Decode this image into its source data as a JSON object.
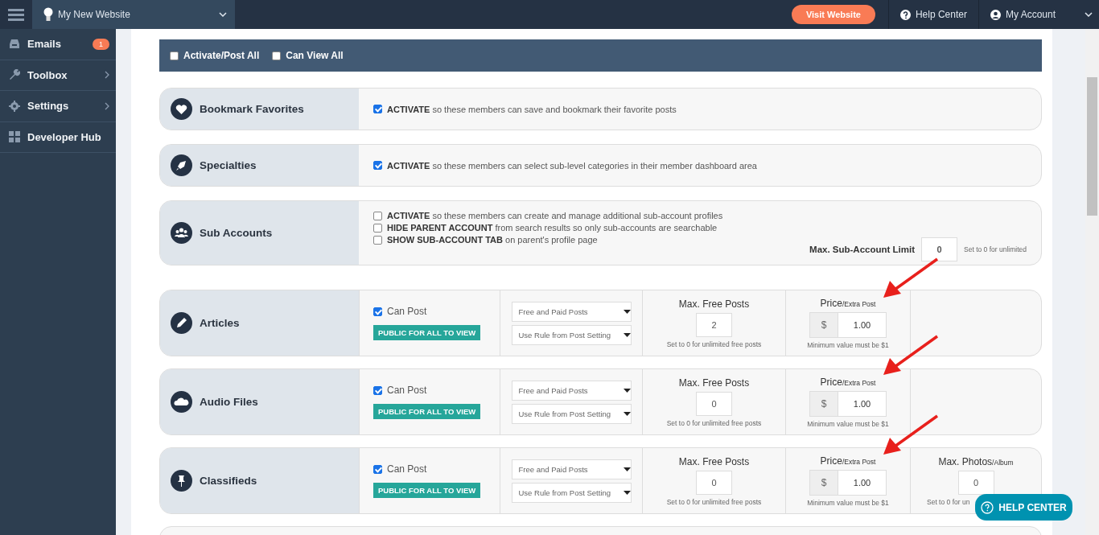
{
  "topbar": {
    "site_name": "My New Website",
    "visit_button": "Visit Website",
    "help_link": "Help Center",
    "account": "My Account"
  },
  "sidebar": {
    "items": [
      {
        "label": "Emails",
        "badge": "1",
        "has_submenu": false
      },
      {
        "label": "Toolbox",
        "has_submenu": true
      },
      {
        "label": "Settings",
        "has_submenu": true
      },
      {
        "label": "Developer Hub",
        "has_submenu": false
      }
    ]
  },
  "bulk_options": [
    {
      "label": "Activate/Post All",
      "checked": false
    },
    {
      "label": "Can View All",
      "checked": false
    }
  ],
  "features": [
    {
      "kind": "simple",
      "name": "Bookmark Favorites",
      "options": [
        {
          "text": "**ACTIVATE** so these members can save and bookmark their favorite posts",
          "checked": true
        }
      ]
    },
    {
      "kind": "simple",
      "name": "Specialties",
      "options": [
        {
          "text": "**ACTIVATE** so these members can select sub-level categories in their member dashboard area",
          "checked": true
        }
      ]
    },
    {
      "kind": "sub",
      "name": "Sub Accounts",
      "options": [
        {
          "text": "**ACTIVATE** so these members can create and manage additional sub-account profiles",
          "checked": false
        },
        {
          "text": "**HIDE PARENT ACCOUNT** from search results so only sub-accounts are searchable",
          "checked": false
        },
        {
          "text": "**SHOW SUB-ACCOUNT TAB** on parent's profile page",
          "checked": false
        }
      ],
      "limit": {
        "label": "Max. Sub-Account Limit",
        "value": "0",
        "hint": "Set to 0 for unlimited"
      }
    },
    {
      "kind": "post",
      "name": "Articles",
      "can_post": {
        "label": "Can Post",
        "checked": true
      },
      "badge": "PUBLIC FOR ALL TO VIEW",
      "selects": [
        "Free and Paid Posts",
        "Use Rule from Post Setting"
      ],
      "max_free": {
        "label": "Max. Free Posts",
        "value": "2",
        "hint": "Set to 0 for unlimited free posts"
      },
      "price": {
        "label": "Price",
        "suffix": "/Extra Post",
        "currency": "$",
        "value": "1.00",
        "hint": "Minimum value must be $1"
      }
    },
    {
      "kind": "post",
      "name": "Audio Files",
      "can_post": {
        "label": "Can Post",
        "checked": true
      },
      "badge": "PUBLIC FOR ALL TO VIEW",
      "selects": [
        "Free and Paid Posts",
        "Use Rule from Post Setting"
      ],
      "max_free": {
        "label": "Max. Free Posts",
        "value": "0",
        "hint": "Set to 0 for unlimited free posts"
      },
      "price": {
        "label": "Price",
        "suffix": "/Extra Post",
        "currency": "$",
        "value": "1.00",
        "hint": "Minimum value must be $1"
      }
    },
    {
      "kind": "post",
      "name": "Classifieds",
      "can_post": {
        "label": "Can Post",
        "checked": true
      },
      "badge": "PUBLIC FOR ALL TO VIEW",
      "selects": [
        "Free and Paid Posts",
        "Use Rule from Post Setting"
      ],
      "max_free": {
        "label": "Max. Free Posts",
        "value": "0",
        "hint": "Set to 0 for unlimited free posts"
      },
      "price": {
        "label": "Price",
        "suffix": "/Extra Post",
        "currency": "$",
        "value": "1.00",
        "hint": "Minimum value must be $1"
      },
      "extra": {
        "label": "Max. Photos",
        "suffix": "/Album",
        "value": "0",
        "hint": "Set to 0 for un"
      }
    },
    {
      "kind": "blank"
    }
  ],
  "help_button": "HELP CENTER"
}
